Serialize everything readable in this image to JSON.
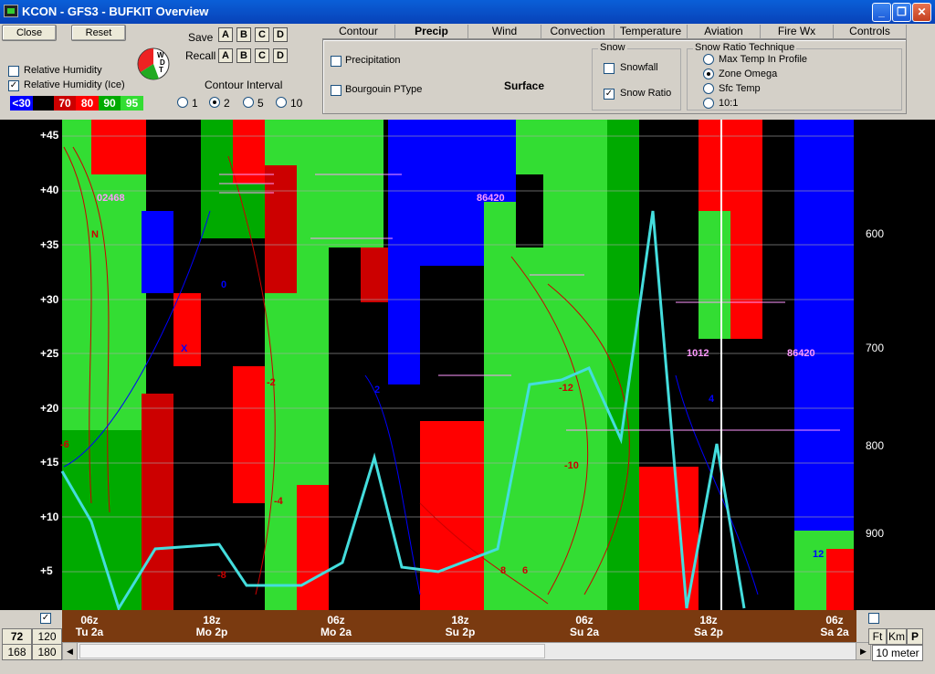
{
  "window": {
    "title": "KCON - GFS3 - BUFKIT Overview"
  },
  "toolbar": {
    "close_label": "Close",
    "reset_label": "Reset",
    "save_label": "Save",
    "recall_label": "Recall",
    "slot_labels": [
      "A",
      "B",
      "C",
      "D"
    ]
  },
  "overlays": {
    "rh_label": "Relative Humidity",
    "rh_checked": false,
    "rh_ice_label": "Relative Humidity (Ice)",
    "rh_ice_checked": true,
    "legend": [
      {
        "label": "<30",
        "color": "#0000ff"
      },
      {
        "label": "",
        "color": "#000000"
      },
      {
        "label": "70",
        "color": "#cc0000"
      },
      {
        "label": "80",
        "color": "#ff0000"
      },
      {
        "label": "90",
        "color": "#00aa00"
      },
      {
        "label": "95",
        "color": "#33dd33"
      }
    ]
  },
  "contour_interval": {
    "title": "Contour Interval",
    "options": [
      "1",
      "2",
      "5",
      "10"
    ],
    "selected": "2"
  },
  "tabs": [
    "Contour",
    "Precip",
    "Wind",
    "Convection",
    "Temperature",
    "Aviation",
    "Fire Wx",
    "Controls"
  ],
  "active_tab": "Precip",
  "precip_panel": {
    "precipitation_label": "Precipitation",
    "precipitation_checked": false,
    "ptype_label": "Bourgouin PType",
    "ptype_checked": false,
    "surface_label": "Surface",
    "snow_group_title": "Snow",
    "snowfall_label": "Snowfall",
    "snowfall_checked": false,
    "snow_ratio_label": "Snow Ratio",
    "snow_ratio_checked": true,
    "technique_title": "Snow Ratio Technique",
    "techniques": [
      "Max Temp In Profile",
      "Zone Omega",
      "Sfc Temp",
      "10:1"
    ],
    "technique_selected": "Zone Omega"
  },
  "plot": {
    "left_axis_labels": [
      "+45",
      "+40",
      "+35",
      "+30",
      "+25",
      "+20",
      "+15",
      "+10",
      "+5"
    ],
    "right_axis_labels": [
      "600",
      "700",
      "800",
      "900"
    ],
    "contour_labels": [
      "-2",
      "-4",
      "-6",
      "-8",
      "-10",
      "-12",
      "0",
      "2",
      "4",
      "6",
      "8",
      "12",
      "N",
      "X",
      "02468",
      "86420",
      "1012",
      "86420"
    ]
  },
  "time_axis": {
    "labels": [
      {
        "top": "06z",
        "bottom": "Tu 2a"
      },
      {
        "top": "18z",
        "bottom": "Mo 2p"
      },
      {
        "top": "06z",
        "bottom": "Mo 2a"
      },
      {
        "top": "18z",
        "bottom": "Su 2p"
      },
      {
        "top": "06z",
        "bottom": "Su 2a"
      },
      {
        "top": "18z",
        "bottom": "Sa 2p"
      },
      {
        "top": "06z",
        "bottom": "Sa 2a"
      }
    ]
  },
  "bottom": {
    "range_buttons": [
      "72",
      "120",
      "168",
      "180"
    ],
    "range_selected": "72",
    "left_checked": true,
    "right_checked": false,
    "unit_buttons": [
      "Ft",
      "Km",
      "P"
    ],
    "wind_level": "10 meter"
  }
}
